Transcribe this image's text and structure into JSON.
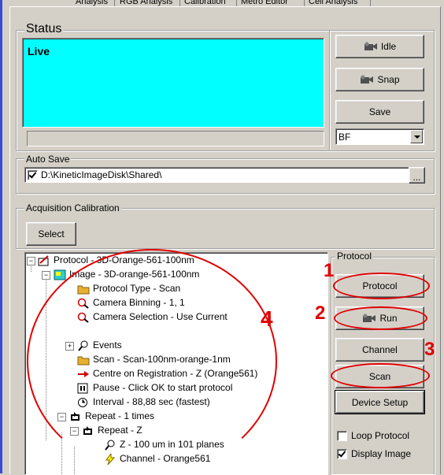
{
  "tabs": [
    "Analysis",
    "RGB Analysis",
    "Calibration",
    "Metro Editor",
    "Cell Analysis"
  ],
  "status": {
    "legend": "Status",
    "live_text": "Live",
    "idle_label": "Idle",
    "snap_label": "Snap",
    "save_label": "Save",
    "mode_selected": "BF"
  },
  "autosave": {
    "legend": "Auto Save",
    "checked": true,
    "path": "D:\\KineticImageDisk\\Shared\\",
    "browse_label": "..."
  },
  "calibration": {
    "legend": "Acquisition Calibration",
    "select_label": "Select"
  },
  "protocol_panel": {
    "legend": "Protocol",
    "protocol_label": "Protocol",
    "run_label": "Run",
    "channel_label": "Channel",
    "scan_label": "Scan",
    "device_setup_label": "Device Setup",
    "loop_protocol_label": "Loop Protocol",
    "loop_protocol_checked": false,
    "display_image_label": "Display Image",
    "display_image_checked": true
  },
  "tree": {
    "items": [
      "Protocol - 3D-Orange-561-100nm",
      "Image - 3D-orange-561-100nm",
      "Protocol Type - Scan",
      "Camera Binning - 1, 1",
      "Camera Selection - Use Current",
      "Events",
      "Scan - Scan-100nm-orange-1nm",
      "Centre on Registration - Z (Orange561)",
      "Pause - Click OK to start protocol",
      "Interval - 88,88 sec (fastest)",
      "Repeat - 1 times",
      "Repeat - Z",
      "Z - 100 um in 101 planes",
      "Channel - Orange561"
    ]
  },
  "annotations": {
    "num1": "1",
    "num2": "2",
    "num3": "3",
    "num4": "4",
    "color": "#e00000"
  }
}
